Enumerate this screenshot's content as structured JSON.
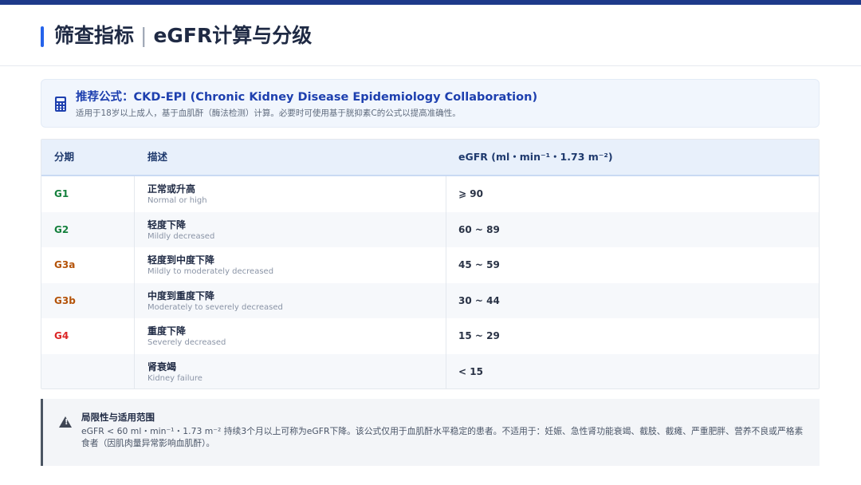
{
  "header": {
    "title_main": "筛查指标",
    "title_separator": "|",
    "title_sub": "eGFR计算与分级"
  },
  "formula": {
    "icon": "calculator-icon",
    "title": "推荐公式：CKD-EPI (Chronic Kidney Disease Epidemiology Collaboration)",
    "subtitle": "适用于18岁以上成人，基于血肌酐（酶法检测）计算。必要时可使用基于胱抑素C的公式以提高准确性。"
  },
  "table": {
    "headers": [
      "分期",
      "描述",
      "eGFR (ml・min⁻¹・1.73 m⁻²)"
    ],
    "rows": [
      {
        "stage": "G1",
        "color": "#15803d",
        "desc_zh": "正常或升高",
        "desc_en": "Normal or high",
        "range": "⩾ 90"
      },
      {
        "stage": "G2",
        "color": "#15803d",
        "desc_zh": "轻度下降",
        "desc_en": "Mildly decreased",
        "range": "60 ~ 89"
      },
      {
        "stage": "G3a",
        "color": "#b45309",
        "desc_zh": "轻度到中度下降",
        "desc_en": "Mildly to moderately decreased",
        "range": "45 ~ 59"
      },
      {
        "stage": "G3b",
        "color": "#b45309",
        "desc_zh": "中度到重度下降",
        "desc_en": "Moderately to severely decreased",
        "range": "30 ~ 44"
      },
      {
        "stage": "G4",
        "color": "#dc2626",
        "desc_zh": "重度下降",
        "desc_en": "Severely decreased",
        "range": "15 ~ 29"
      },
      {
        "stage": "",
        "color": "#991b1b",
        "desc_zh": "肾衰竭",
        "desc_en": "Kidney failure",
        "range": "< 15"
      }
    ]
  },
  "note": {
    "icon": "warning-icon",
    "title": "局限性与适用范围",
    "body": "eGFR < 60 ml・min⁻¹・1.73 m⁻² 持续3个月以上可称为eGFR下降。该公式仅用于血肌酐水平稳定的患者。不适用于：妊娠、急性肾功能衰竭、截肢、截瘫、严重肥胖、营养不良或严格素食者（因肌肉量异常影响血肌酐）。"
  }
}
